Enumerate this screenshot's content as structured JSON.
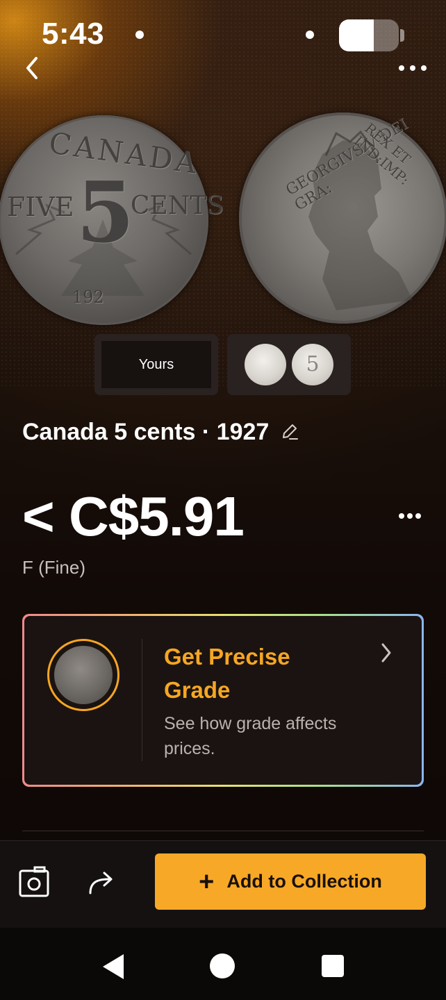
{
  "status_bar": {
    "time": "5:43",
    "battery_level": 0.58
  },
  "header": {
    "back_icon": "chevron-left-icon",
    "more_icon": "more-horizontal-icon"
  },
  "coin_images": {
    "reverse_text_top": "CANADA",
    "reverse_text_left": "FIVE",
    "reverse_denomination": "5",
    "reverse_text_right": "CENTS",
    "reverse_year": "192",
    "obverse_legend_left": "GEORGIVS V DEI GRA:",
    "obverse_legend_right": "REX ET IND:IMP:"
  },
  "thumbnails": {
    "yours_label": "Yours",
    "reference_mini_label": "5"
  },
  "coin": {
    "title": "Canada 5 cents · 1927",
    "edit_icon": "pencil-icon",
    "price": "< C$5.91",
    "grade": "F (Fine)"
  },
  "grade_card": {
    "title": "Get Precise Grade",
    "description": "See how grade affects prices.",
    "chevron_icon": "chevron-right-icon",
    "accent_color": "#f5a623"
  },
  "bottom_bar": {
    "camera_icon": "camera-icon",
    "share_icon": "share-icon",
    "add_label": "Add to Collection",
    "add_icon": "plus-icon",
    "accent_color": "#f7a826"
  },
  "nav_bar": {
    "back_icon": "nav-back-icon",
    "home_icon": "nav-home-icon",
    "recents_icon": "nav-recents-icon"
  }
}
